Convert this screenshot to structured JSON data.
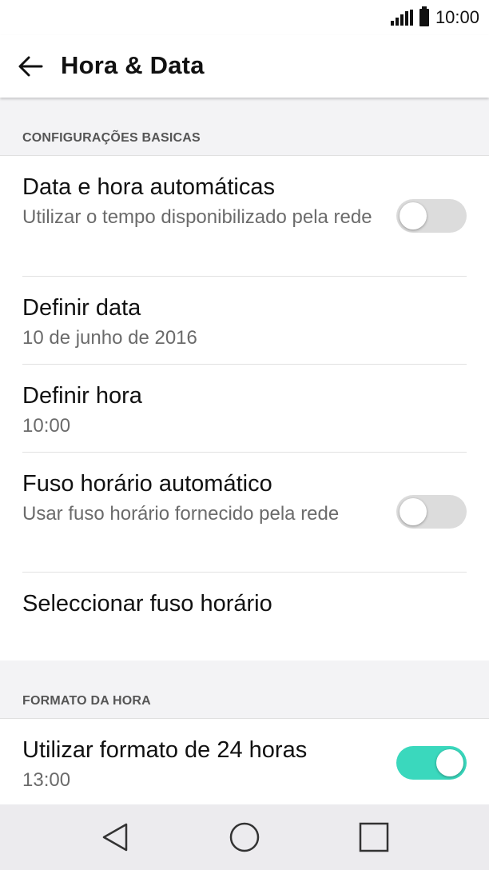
{
  "status_bar": {
    "time": "10:00",
    "icons": [
      "signal-icon",
      "battery-icon"
    ]
  },
  "app_bar": {
    "title": "Hora & Data",
    "back_icon": "arrow-left-icon"
  },
  "sections": [
    {
      "header": "CONFIGURAÇÕES BASICAS",
      "items": [
        {
          "title": "Data e hora automáticas",
          "subtitle": "Utilizar o tempo disponibilizado pela rede",
          "toggle": false
        },
        {
          "title": "Definir data",
          "subtitle": "10 de junho de 2016"
        },
        {
          "title": "Definir hora",
          "subtitle": "10:00"
        },
        {
          "title": "Fuso horário automático",
          "subtitle": "Usar fuso horário fornecido pela rede",
          "toggle": false
        },
        {
          "title": "Seleccionar fuso horário"
        }
      ]
    },
    {
      "header": "FORMATO DA HORA",
      "items": [
        {
          "title": "Utilizar formato de 24 horas",
          "subtitle": "13:00",
          "toggle": true
        }
      ]
    }
  ],
  "nav_bar": {
    "icons": [
      "back-triangle-icon",
      "home-circle-icon",
      "recents-square-icon"
    ]
  },
  "colors": {
    "toggle_on": "#3ad8bd",
    "toggle_off": "#dcdcdc",
    "section_bg": "#f3f3f5",
    "nav_bg": "#ecebee"
  }
}
